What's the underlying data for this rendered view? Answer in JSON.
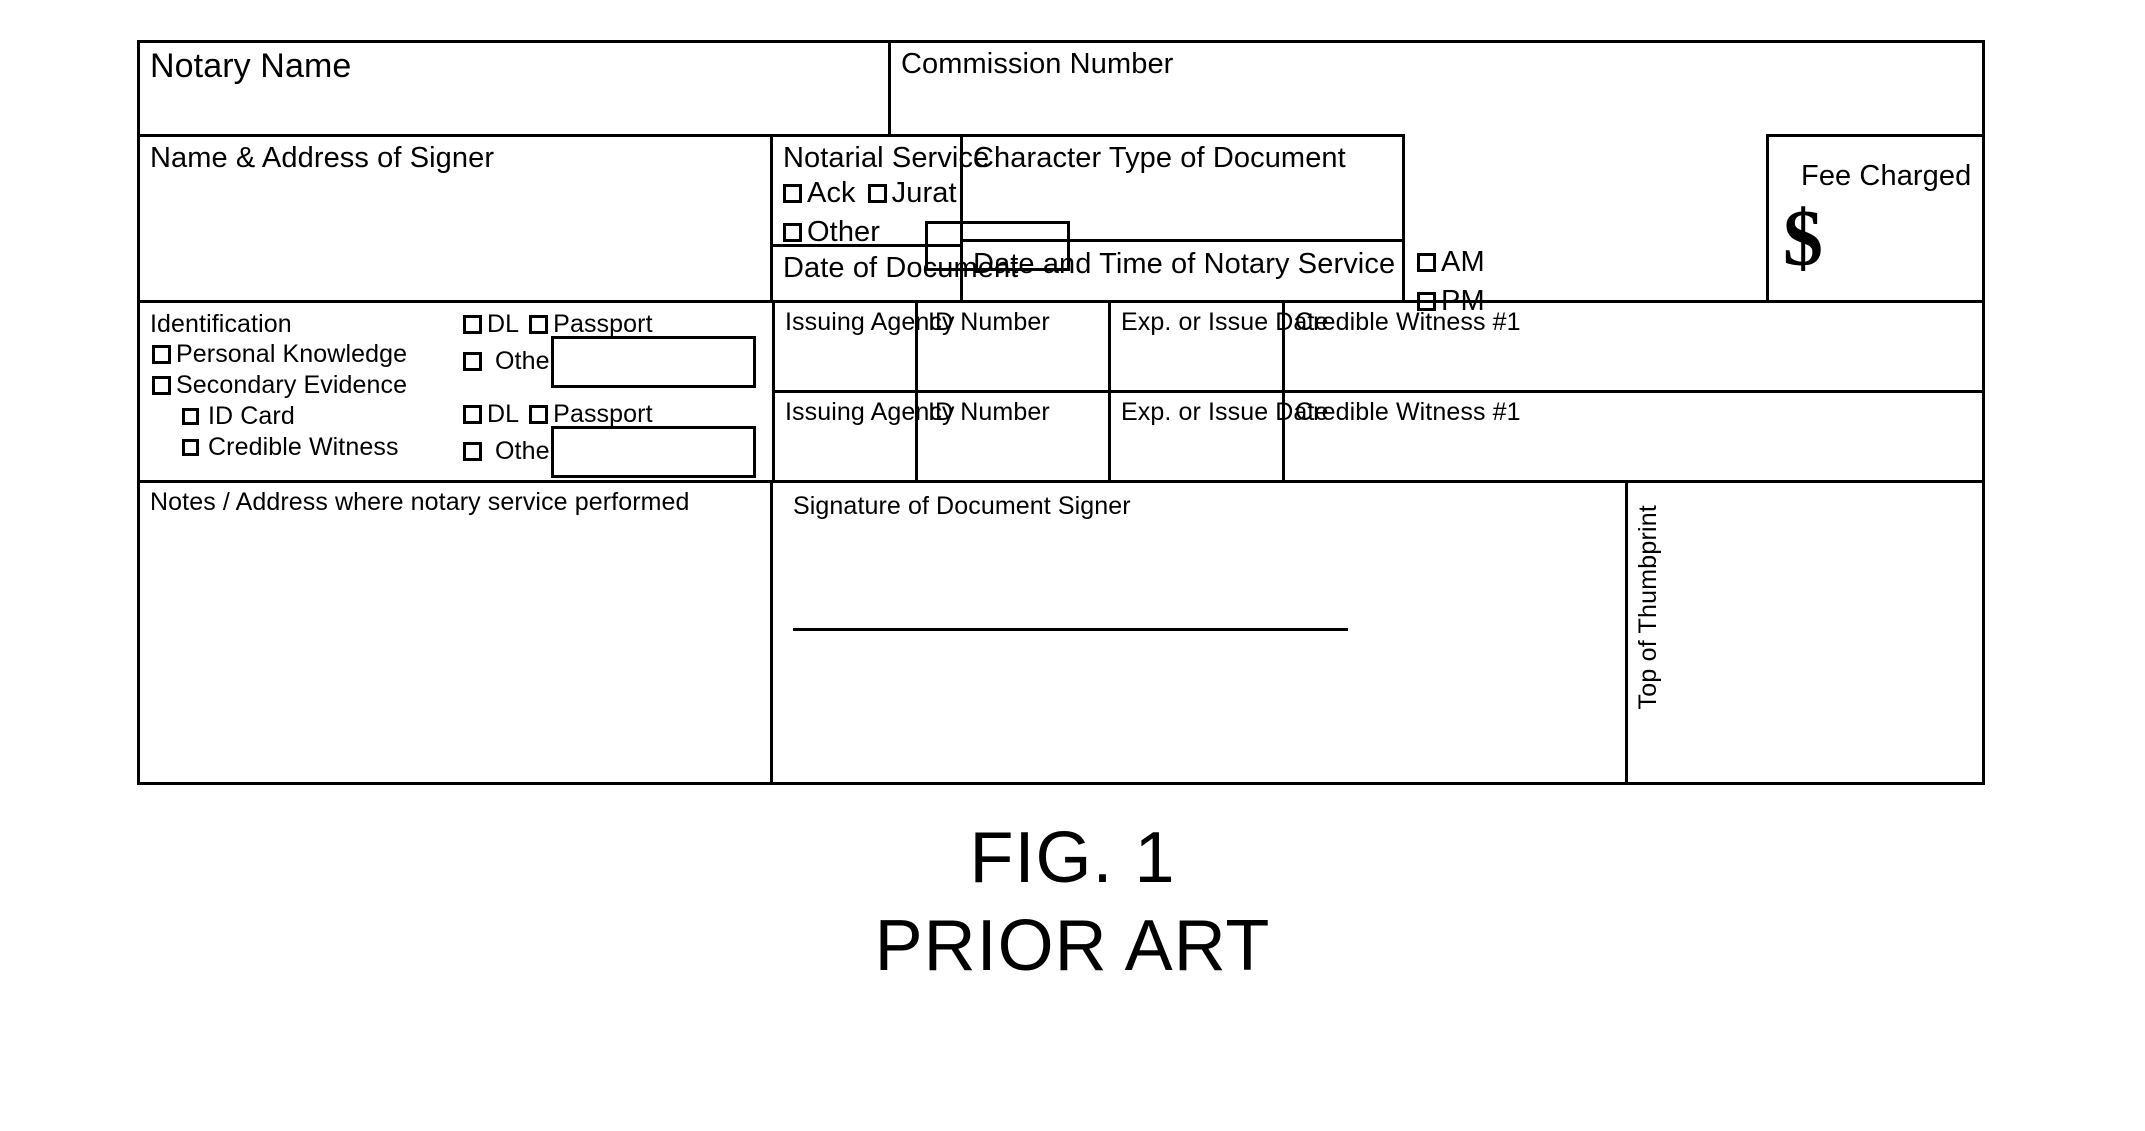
{
  "figure": {
    "caption_line1": "FIG. 1",
    "caption_line2": "PRIOR ART"
  },
  "form": {
    "row_header": {
      "notary_name_label": "Notary Name",
      "commission_number_label": "Commission Number"
    },
    "row_signer": {
      "name_address_label": "Name & Address of Signer",
      "notarial_service": {
        "title": "Notarial Service",
        "option_ack": "Ack",
        "option_jurat": "Jurat",
        "option_other": "Other",
        "other_value": ""
      },
      "date_of_document_label": "Date of Document",
      "character_type_label": "Character Type of Document",
      "date_time_service_label": "Date and Time of Notary Service",
      "am_label": "AM",
      "pm_label": "PM",
      "fee_charged_label": "Fee Charged",
      "fee_currency_symbol": "$",
      "fee_value": ""
    },
    "row_identification": {
      "identification_label": "Identification",
      "personal_knowledge_label": "Personal Knowledge",
      "secondary_evidence_label": "Secondary Evidence",
      "id_card_label": "ID Card",
      "credible_witness_label": "Credible Witness",
      "id_types": [
        {
          "dl_label": "DL",
          "passport_label": "Passport",
          "other_label": "Other",
          "other_value": ""
        },
        {
          "dl_label": "DL",
          "passport_label": "Passport",
          "other_label": "Other",
          "other_value": ""
        }
      ],
      "detail_columns": [
        "Issuing Agency",
        "ID Number",
        "Exp. or Issue Date",
        "Credible Witness #1"
      ],
      "detail_rows": [
        {
          "issuing_agency_label": "Issuing Agency",
          "id_number_label": "ID Number",
          "exp_issue_date_label": "Exp. or Issue Date",
          "credible_witness_label": "Credible Witness #1"
        },
        {
          "issuing_agency_label": "Issuing Agency",
          "id_number_label": "ID Number",
          "exp_issue_date_label": "Exp. or Issue Date",
          "credible_witness_label": "Credible Witness #1"
        }
      ]
    },
    "row_footer": {
      "notes_label": "Notes / Address where notary service performed",
      "signature_label": "Signature of Document Signer",
      "thumbprint_label": "Top of Thumbprint"
    }
  }
}
